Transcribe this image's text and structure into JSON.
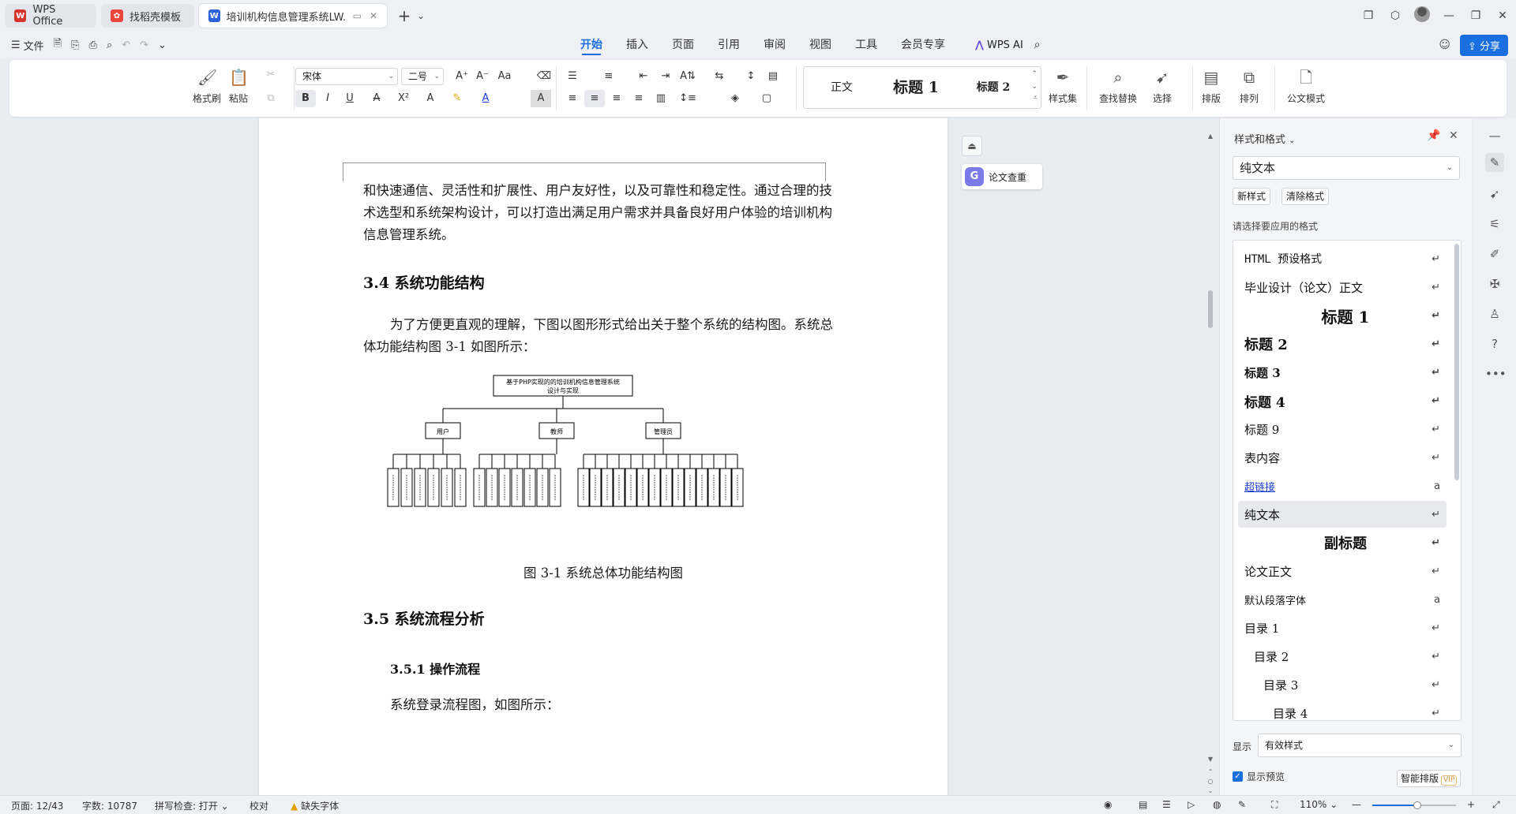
{
  "tabs": [
    {
      "label": "WPS Office",
      "icon": "wps-logo-icon",
      "color": "#d8342b"
    },
    {
      "label": "找稻壳模板",
      "icon": "docer-logo-icon",
      "color": "#e8453c"
    },
    {
      "label": "培训机构信息管理系统LW.doc",
      "icon": "word-doc-icon",
      "color": "#2b62d9",
      "active": true
    }
  ],
  "menu": {
    "file_label": "文件",
    "tabs": [
      "开始",
      "插入",
      "页面",
      "引用",
      "审阅",
      "视图",
      "工具",
      "会员专享"
    ],
    "active_tab": "开始",
    "ai_label": "WPS AI",
    "share_label": "分享"
  },
  "ribbon": {
    "format_painter": "格式刷",
    "paste": "粘贴",
    "font_name": "宋体",
    "font_size": "二号",
    "style_gallery": [
      "正文",
      "标题 1",
      "标题 2"
    ],
    "style_set": "样式集",
    "find_replace": "查找替换",
    "select": "选择",
    "layout": "排版",
    "arrange": "排列",
    "official_mode": "公文模式"
  },
  "document": {
    "para1": "和快速通信、灵活性和扩展性、用户友好性，以及可靠性和稳定性。通过合理的技术选型和系统架构设计，可以打造出满足用户需求并具备良好用户体验的培训机构信息管理系统。",
    "heading_34": "3.4 系统功能结构",
    "para2": "为了方便更直观的理解，下图以图形形式给出关于整个系统的结构图。系统总体功能结构图 3-1 如图所示：",
    "diagram": {
      "root": "基于PHP实现的的培训机构信息管理系统设计与实现",
      "roles": [
        "用户",
        "教师",
        "管理员"
      ]
    },
    "caption": "图 3-1 系统总体功能结构图",
    "heading_35": "3.5 系统流程分析",
    "heading_351": "3.5.1 操作流程",
    "para3": "系统登录流程图，如图所示："
  },
  "side_float": {
    "paper_check": "论文查重"
  },
  "styles_panel": {
    "title": "样式和格式",
    "current_style": "纯文本",
    "new_style": "新样式",
    "clear_format": "清除格式",
    "hint": "请选择要应用的格式",
    "items": [
      {
        "label": "HTML 预设格式",
        "mark": "↵"
      },
      {
        "label": "毕业设计（论文）正文",
        "mark": "↵"
      },
      {
        "label": "标题 1",
        "mark": "↵"
      },
      {
        "label": "标题 2",
        "mark": "↵"
      },
      {
        "label": "标题 3",
        "mark": "↵"
      },
      {
        "label": "标题 4",
        "mark": "↵"
      },
      {
        "label": "标题 9",
        "mark": "↵"
      },
      {
        "label": "表内容",
        "mark": "↵"
      },
      {
        "label": "超链接",
        "mark": "a"
      },
      {
        "label": "纯文本",
        "mark": "↵"
      },
      {
        "label": "副标题",
        "mark": "↵"
      },
      {
        "label": "论文正文",
        "mark": "↵"
      },
      {
        "label": "默认段落字体",
        "mark": "a"
      },
      {
        "label": "目录 1",
        "mark": "↵"
      },
      {
        "label": "目录 2",
        "mark": "↵"
      },
      {
        "label": "目录 3",
        "mark": "↵"
      },
      {
        "label": "目录 4",
        "mark": "↵"
      }
    ],
    "show_label": "显示",
    "show_value": "有效样式",
    "show_preview": "显示预览",
    "smart_layout": "智能排版",
    "vip": "VIP"
  },
  "status": {
    "page": "页面: 12/43",
    "words": "字数: 10787",
    "spell": "拼写检查: 打开",
    "proof": "校对",
    "missing_font": "缺失字体",
    "zoom": "110%"
  }
}
